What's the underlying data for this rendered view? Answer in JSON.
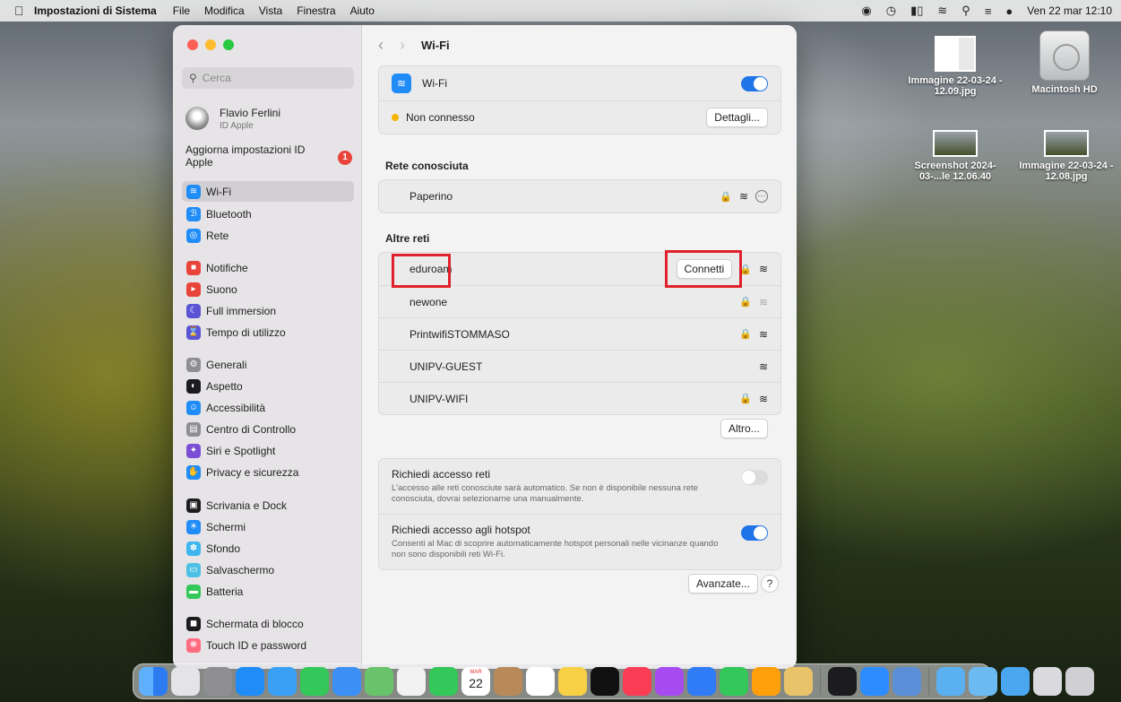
{
  "menubar": {
    "app_name": "Impostazioni di Sistema",
    "menus": [
      "File",
      "Modifica",
      "Vista",
      "Finestra",
      "Aiuto"
    ],
    "clock": "Ven 22 mar 12:10"
  },
  "desktop": {
    "icons": [
      {
        "label": "Immagine 22-03-24 - 12.09.jpg"
      },
      {
        "label": "Macintosh HD"
      },
      {
        "label": "Screenshot 2024-03-...le 12.06.40"
      },
      {
        "label": "Immagine 22-03-24 - 12.08.jpg"
      }
    ]
  },
  "sidebar": {
    "search_placeholder": "Cerca",
    "account": {
      "name": "Flavio Ferlini",
      "sub": "ID Apple"
    },
    "update": {
      "label": "Aggiorna impostazioni ID Apple",
      "badge": "1"
    },
    "items": [
      {
        "label": "Wi-Fi",
        "icon": "wifi-icon",
        "color": "#1f8cf7"
      },
      {
        "label": "Bluetooth",
        "icon": "bluetooth-icon",
        "color": "#1f8cf7"
      },
      {
        "label": "Rete",
        "icon": "globe-icon",
        "color": "#1f8cf7"
      },
      {
        "label": "Notifiche",
        "icon": "bell-icon",
        "color": "#e8443a"
      },
      {
        "label": "Suono",
        "icon": "speaker-icon",
        "color": "#e8443a"
      },
      {
        "label": "Full immersion",
        "icon": "moon-icon",
        "color": "#5b55d6"
      },
      {
        "label": "Tempo di utilizzo",
        "icon": "hourglass-icon",
        "color": "#5b55d6"
      },
      {
        "label": "Generali",
        "icon": "gear-icon",
        "color": "#8e8e93"
      },
      {
        "label": "Aspetto",
        "icon": "appearance-icon",
        "color": "#1c1c1e"
      },
      {
        "label": "Accessibilità",
        "icon": "accessibility-icon",
        "color": "#1f8cf7"
      },
      {
        "label": "Centro di Controllo",
        "icon": "control-center-icon",
        "color": "#8e8e93"
      },
      {
        "label": "Siri e Spotlight",
        "icon": "siri-icon",
        "color": "#7a4fd6"
      },
      {
        "label": "Privacy e sicurezza",
        "icon": "hand-icon",
        "color": "#1f8cf7"
      },
      {
        "label": "Scrivania e Dock",
        "icon": "dock-icon",
        "color": "#1c1c1e"
      },
      {
        "label": "Schermi",
        "icon": "display-icon",
        "color": "#1f8cf7"
      },
      {
        "label": "Sfondo",
        "icon": "wallpaper-icon",
        "color": "#3fb6f0"
      },
      {
        "label": "Salvaschermo",
        "icon": "screensaver-icon",
        "color": "#4ec0e6"
      },
      {
        "label": "Batteria",
        "icon": "battery-icon",
        "color": "#34c759"
      },
      {
        "label": "Schermata di blocco",
        "icon": "lock-screen-icon",
        "color": "#1c1c1e"
      },
      {
        "label": "Touch ID e password",
        "icon": "fingerprint-icon",
        "color": "#ff6b81"
      }
    ]
  },
  "main": {
    "title": "Wi-Fi",
    "wifi_row": {
      "label": "Wi-Fi",
      "enabled": true
    },
    "status_row": {
      "status": "Non connesso",
      "status_color": "#f5b400",
      "details_button": "Dettagli..."
    },
    "known_title": "Rete conosciuta",
    "known_networks": [
      {
        "name": "Paperino",
        "locked": true
      }
    ],
    "other_title": "Altre reti",
    "other_networks": [
      {
        "name": "eduroam",
        "locked": true,
        "connect_button": "Connetti"
      },
      {
        "name": "newone",
        "locked": true
      },
      {
        "name": "PrintwifiSTOMMASO",
        "locked": true
      },
      {
        "name": "UNIPV-GUEST",
        "locked": false
      },
      {
        "name": "UNIPV-WIFI",
        "locked": true
      }
    ],
    "other_button": "Altro...",
    "ask_networks": {
      "label": "Richiedi accesso reti",
      "desc": "L'accesso alle reti conosciute sarà automatico. Se non è disponibile nessuna rete conosciuta, dovrai selezionarne una manualmente.",
      "enabled": false
    },
    "ask_hotspots": {
      "label": "Richiedi accesso agli hotspot",
      "desc": "Consenti al Mac di scoprire automaticamente hotspot personali nelle vicinanze quando non sono disponibili reti Wi-Fi.",
      "enabled": true
    },
    "advanced_button": "Avanzate...",
    "help_button": "?"
  },
  "dock": {
    "calendar_month": "MAR",
    "calendar_day": "22",
    "apps": [
      "finder-icon",
      "launchpad-icon",
      "settings-icon",
      "app-store-icon",
      "safari-icon",
      "messages-icon",
      "mail-icon",
      "maps-icon",
      "photos-icon",
      "facetime-icon",
      "calendar-icon",
      "contacts-icon",
      "reminders-icon",
      "notes-icon",
      "tv-icon",
      "music-icon",
      "podcasts-icon",
      "keynote-icon",
      "numbers-icon",
      "pages-icon",
      "iwork-icon",
      "terminal-icon",
      "zoom-icon",
      "preview-icon",
      "folder-icon",
      "documents-icon",
      "downloads-icon",
      "screenshot-icon",
      "trash-icon"
    ]
  }
}
